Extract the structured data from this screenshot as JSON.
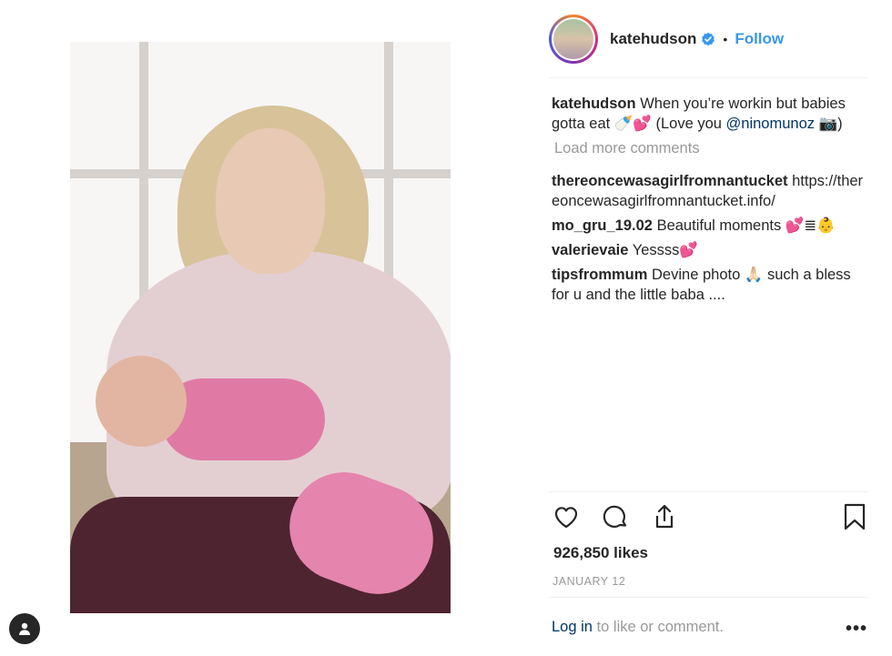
{
  "post": {
    "author": {
      "username": "katehudson",
      "verified": true,
      "follow_label": "Follow",
      "separator": "•"
    },
    "caption": {
      "username": "katehudson",
      "text_before_mention": "When you’re workin but babies gotta eat 🍼💕 (Love you ",
      "mention": "@ninomunoz",
      "text_after_mention": " 📷)"
    },
    "load_more_label": "Load more comments",
    "comments": [
      {
        "username": "thereoncewasagirlfromnantucket",
        "text": "https://thereoncewasagirlfromnantucket.info/"
      },
      {
        "username": "mo_gru_19.02",
        "text": "Beautiful moments 💕≣👶"
      },
      {
        "username": "valerievaie",
        "text": "Yessss💕"
      },
      {
        "username": "tipsfrommum",
        "text": "Devine photo 🙏🏻 such a bless for u and the little baba ...."
      }
    ],
    "likes": "926,850 likes",
    "date": "JANUARY 12",
    "login": {
      "link_label": "Log in",
      "rest_text": " to like or comment."
    },
    "more_label": "•••"
  },
  "icons": {
    "like": "heart-icon",
    "comment": "comment-bubble-icon",
    "share": "share-icon",
    "save": "bookmark-icon",
    "profile": "person-icon",
    "verified": "verified-badge-icon"
  },
  "colors": {
    "link_blue": "#3897f0",
    "mention_blue": "#003569",
    "muted_gray": "#999999",
    "text_dark": "#262626"
  }
}
